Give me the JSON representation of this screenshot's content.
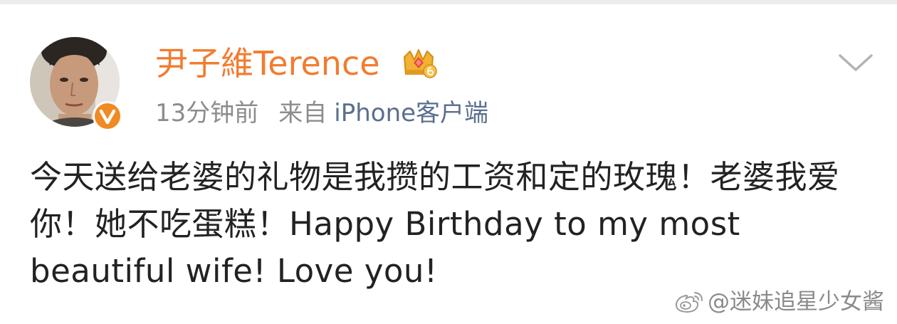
{
  "post": {
    "username": "尹子維Terence",
    "time": "13分钟前",
    "from_label": "来自",
    "source": "iPhone客户端",
    "text": "今天送给老婆的礼物是我攒的工资和定的玫瑰！老婆我爱你！她不吃蛋糕！Happy Birthday to my most beautiful wife!  Love you!"
  },
  "icons": {
    "avatar": "avatar",
    "verified": "verified-v-icon",
    "crown": "crown-icon",
    "expand": "chevron-down-icon",
    "watermark_logo": "weibo-logo-icon"
  },
  "watermark": {
    "text": "@迷妹追星少女酱"
  },
  "colors": {
    "username": "#f27c2f",
    "meta": "#8c8c8c",
    "source": "#5b6e8e",
    "text": "#222222",
    "verified": "#f08a24",
    "crown": "#f2b233"
  }
}
